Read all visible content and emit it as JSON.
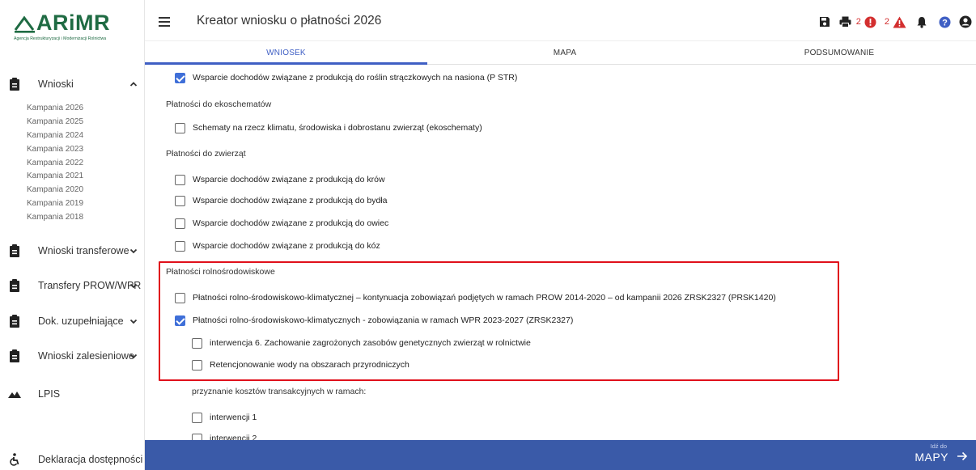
{
  "brand": {
    "logo_text": "ARiMR",
    "logo_subtitle": "Agencja Restrukturyzacji i Modernizacji Rolnictwa",
    "color": "#1f6b43"
  },
  "header": {
    "title": "Kreator wniosku o płatności 2026",
    "errors_count": "2",
    "warnings_count": "2"
  },
  "tabs": [
    {
      "label": "WNIOSEK",
      "active": true
    },
    {
      "label": "MAPA",
      "active": false
    },
    {
      "label": "PODSUMOWANIE",
      "active": false
    }
  ],
  "sidebar": {
    "wnioski": "Wnioski",
    "campaigns": [
      "Kampania 2026",
      "Kampania 2025",
      "Kampania 2024",
      "Kampania 2023",
      "Kampania 2022",
      "Kampania 2021",
      "Kampania 2020",
      "Kampania 2019",
      "Kampania 2018"
    ],
    "wnioski_transferowe": "Wnioski transferowe",
    "transfery": "Transfery PROW/WPR",
    "dok_uzupelniajace": "Dok. uzupełniające",
    "wnioski_zalesieniowe": "Wnioski zalesieniowe",
    "lpis": "LPIS",
    "deklaracja": "Deklaracja dostępności"
  },
  "content": {
    "str": {
      "label": "Wsparcie dochodów związane z produkcją do roślin strączkowych na nasiona (P STR)",
      "checked": true
    },
    "eko_heading": "Płatności do ekoschematów",
    "eko": {
      "label": "Schematy na rzecz klimatu, środowiska i dobrostanu zwierząt (ekoschematy)",
      "checked": false
    },
    "zwierzeta_heading": "Płatności do zwierząt",
    "krow": {
      "label": "Wsparcie dochodów związane z produkcją do krów",
      "checked": false
    },
    "bydla": {
      "label": "Wsparcie dochodów związane z produkcją do bydła",
      "checked": false
    },
    "owiec": {
      "label": "Wsparcie dochodów związane z produkcją do owiec",
      "checked": false
    },
    "koz": {
      "label": "Wsparcie dochodów związane z produkcją do kóz",
      "checked": false
    },
    "rolno_heading": "Płatności rolnośrodowiskowe",
    "prsk1420": {
      "label": "Płatności rolno-środowiskowo-klimatycznej – kontynuacja zobowiązań podjętych w ramach PROW 2014-2020 – od kampanii 2026 ZRSK2327 (PRSK1420)",
      "checked": false
    },
    "zrsk2327": {
      "label": "Płatności rolno-środowiskowo-klimatycznych - zobowiązania w ramach WPR 2023-2027 (ZRSK2327)",
      "checked": true
    },
    "interwencja6": {
      "label": "interwencja 6. Zachowanie zagrożonych zasobów genetycznych zwierząt w rolnictwie",
      "checked": false
    },
    "retencjonowanie": {
      "label": "Retencjonowanie wody na obszarach przyrodniczych",
      "checked": false
    },
    "koszty_heading": "przyznanie kosztów transakcyjnych w ramach:",
    "interwencji1": {
      "label": "interwencji 1",
      "checked": false
    },
    "interwencji2": {
      "label": "interwencji 2",
      "checked": false
    }
  },
  "footer": {
    "next_small": "Idź do",
    "next_big": "MAPY"
  },
  "colors": {
    "primary": "#3f5fc4",
    "checkbox_checked": "#3f6fd8",
    "footer": "#3a5aa8",
    "highlight": "#e0101b",
    "error": "#d32f2f"
  }
}
